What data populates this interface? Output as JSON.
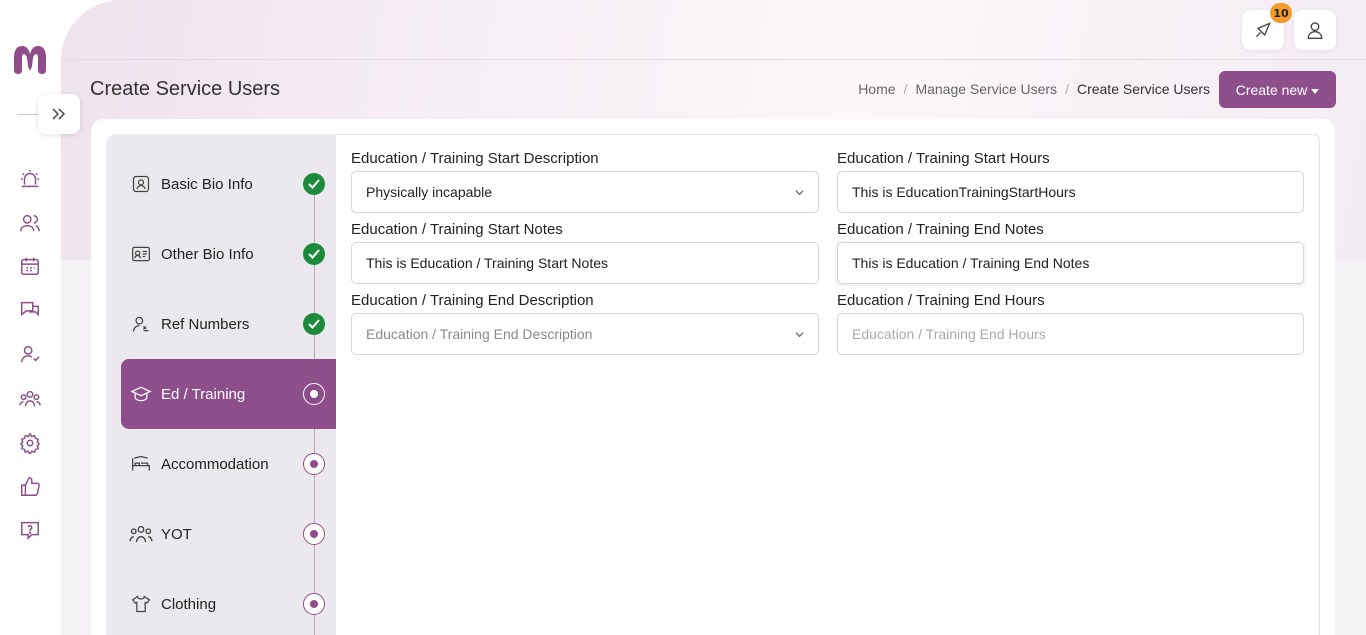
{
  "header": {
    "notification_count": "10",
    "page_title": "Create Service Users",
    "breadcrumb": [
      "Home",
      "Manage Service Users",
      "Create Service Users"
    ],
    "create_button": "Create new"
  },
  "rail": {
    "icons": [
      "alarm-icon",
      "users-icon",
      "calendar-icon",
      "chat-icon",
      "user-manage-icon",
      "team-icon",
      "settings-icon",
      "thumbs-up-icon",
      "help-icon"
    ]
  },
  "steps": [
    {
      "label": "Basic Bio Info",
      "status": "done"
    },
    {
      "label": "Other Bio Info",
      "status": "done"
    },
    {
      "label": "Ref Numbers",
      "status": "done"
    },
    {
      "label": "Ed / Training",
      "status": "current"
    },
    {
      "label": "Accommodation",
      "status": "pending"
    },
    {
      "label": "YOT",
      "status": "pending"
    },
    {
      "label": "Clothing",
      "status": "pending"
    }
  ],
  "form": {
    "start_description": {
      "label": "Education / Training Start Description",
      "value": "Physically incapable"
    },
    "start_hours": {
      "label": "Education / Training Start Hours",
      "value": "This is EducationTrainingStartHours"
    },
    "start_notes": {
      "label": "Education / Training Start Notes",
      "value": "This is Education / Training Start Notes"
    },
    "end_notes": {
      "label": "Education / Training End Notes",
      "value": "This is Education / Training End Notes"
    },
    "end_description": {
      "label": "Education / Training End Description",
      "placeholder": "Education / Training End Description"
    },
    "end_hours": {
      "label": "Education / Training End Hours",
      "placeholder": "Education / Training End Hours"
    }
  },
  "colors": {
    "accent": "#8e4e8c",
    "done": "#1e8a3c",
    "badge": "#f29c2b"
  }
}
